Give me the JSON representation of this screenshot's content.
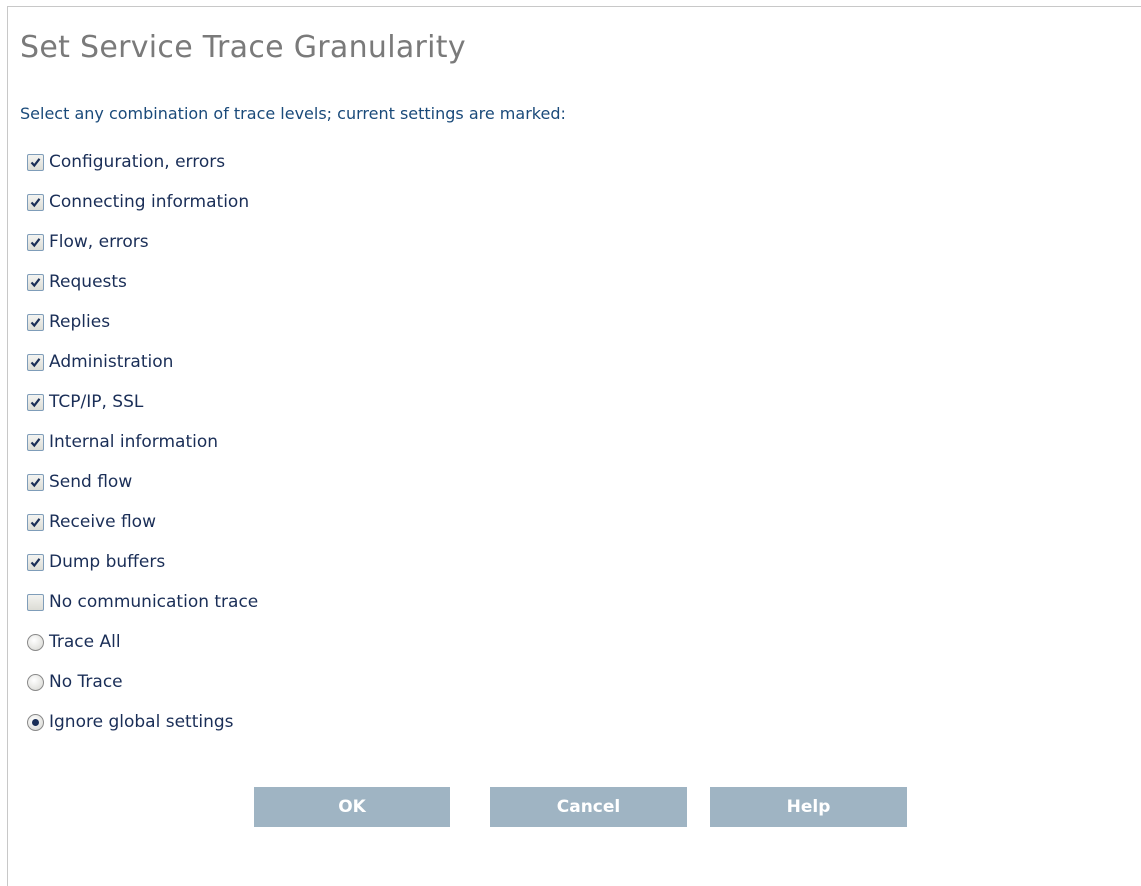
{
  "dialog": {
    "title": "Set Service Trace Granularity",
    "instructions": "Select any combination of trace levels; current settings are marked:"
  },
  "options": [
    {
      "label": "Configuration, errors",
      "type": "checkbox",
      "checked": true
    },
    {
      "label": "Connecting information",
      "type": "checkbox",
      "checked": true
    },
    {
      "label": "Flow, errors",
      "type": "checkbox",
      "checked": true
    },
    {
      "label": "Requests",
      "type": "checkbox",
      "checked": true
    },
    {
      "label": "Replies",
      "type": "checkbox",
      "checked": true
    },
    {
      "label": "Administration",
      "type": "checkbox",
      "checked": true
    },
    {
      "label": "TCP/IP, SSL",
      "type": "checkbox",
      "checked": true
    },
    {
      "label": "Internal information",
      "type": "checkbox",
      "checked": true
    },
    {
      "label": "Send flow",
      "type": "checkbox",
      "checked": true
    },
    {
      "label": "Receive flow",
      "type": "checkbox",
      "checked": true
    },
    {
      "label": "Dump buffers",
      "type": "checkbox",
      "checked": true
    },
    {
      "label": "No communication trace",
      "type": "checkbox",
      "checked": false
    },
    {
      "label": "Trace All",
      "type": "radio",
      "checked": false
    },
    {
      "label": "No Trace",
      "type": "radio",
      "checked": false
    },
    {
      "label": "Ignore global settings",
      "type": "radio",
      "checked": true
    }
  ],
  "buttons": {
    "ok": "OK",
    "cancel": "Cancel",
    "help": "Help"
  },
  "colors": {
    "title": "#7a7a7a",
    "text": "#1a2e57",
    "button_bg": "#9fb4c3",
    "check_mark": "#1a2e57"
  }
}
